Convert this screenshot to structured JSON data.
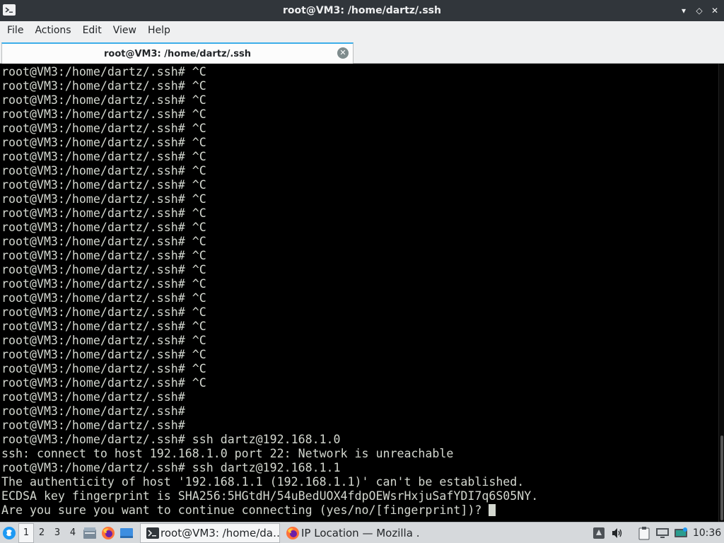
{
  "window": {
    "title": "root@VM3: /home/dartz/.ssh",
    "buttons": {
      "minimize": "▾",
      "maximize": "◇",
      "close": "✕"
    }
  },
  "menu": [
    "File",
    "Actions",
    "Edit",
    "View",
    "Help"
  ],
  "tab": {
    "label": "root@VM3: /home/dartz/.ssh"
  },
  "terminal": {
    "lines": [
      "root@VM3:/home/dartz/.ssh# ^C",
      "root@VM3:/home/dartz/.ssh# ^C",
      "root@VM3:/home/dartz/.ssh# ^C",
      "root@VM3:/home/dartz/.ssh# ^C",
      "root@VM3:/home/dartz/.ssh# ^C",
      "root@VM3:/home/dartz/.ssh# ^C",
      "root@VM3:/home/dartz/.ssh# ^C",
      "root@VM3:/home/dartz/.ssh# ^C",
      "root@VM3:/home/dartz/.ssh# ^C",
      "root@VM3:/home/dartz/.ssh# ^C",
      "root@VM3:/home/dartz/.ssh# ^C",
      "root@VM3:/home/dartz/.ssh# ^C",
      "root@VM3:/home/dartz/.ssh# ^C",
      "root@VM3:/home/dartz/.ssh# ^C",
      "root@VM3:/home/dartz/.ssh# ^C",
      "root@VM3:/home/dartz/.ssh# ^C",
      "root@VM3:/home/dartz/.ssh# ^C",
      "root@VM3:/home/dartz/.ssh# ^C",
      "root@VM3:/home/dartz/.ssh# ^C",
      "root@VM3:/home/dartz/.ssh# ^C",
      "root@VM3:/home/dartz/.ssh# ^C",
      "root@VM3:/home/dartz/.ssh# ^C",
      "root@VM3:/home/dartz/.ssh# ^C",
      "root@VM3:/home/dartz/.ssh# ",
      "root@VM3:/home/dartz/.ssh# ",
      "root@VM3:/home/dartz/.ssh# ",
      "root@VM3:/home/dartz/.ssh# ssh dartz@192.168.1.0",
      "ssh: connect to host 192.168.1.0 port 22: Network is unreachable",
      "root@VM3:/home/dartz/.ssh# ssh dartz@192.168.1.1",
      "The authenticity of host '192.168.1.1 (192.168.1.1)' can't be established.",
      "ECDSA key fingerprint is SHA256:5HGtdH/54uBedUOX4fdpOEWsrHxjuSafYDI7q6S05NY."
    ],
    "prompt_line": "Are you sure you want to continue connecting (yes/no/[fingerprint])? "
  },
  "taskbar": {
    "workspaces": [
      "1",
      "2",
      "3",
      "4"
    ],
    "active_workspace": "1",
    "tasks": [
      {
        "label": "root@VM3: /home/da…",
        "icon": "terminal-icon"
      },
      {
        "label": "IP Location — Mozilla …",
        "icon": "firefox-icon"
      }
    ],
    "clock": "10:36",
    "colors": {
      "accent": "#3daee9",
      "firefox": "#ff7139"
    }
  }
}
